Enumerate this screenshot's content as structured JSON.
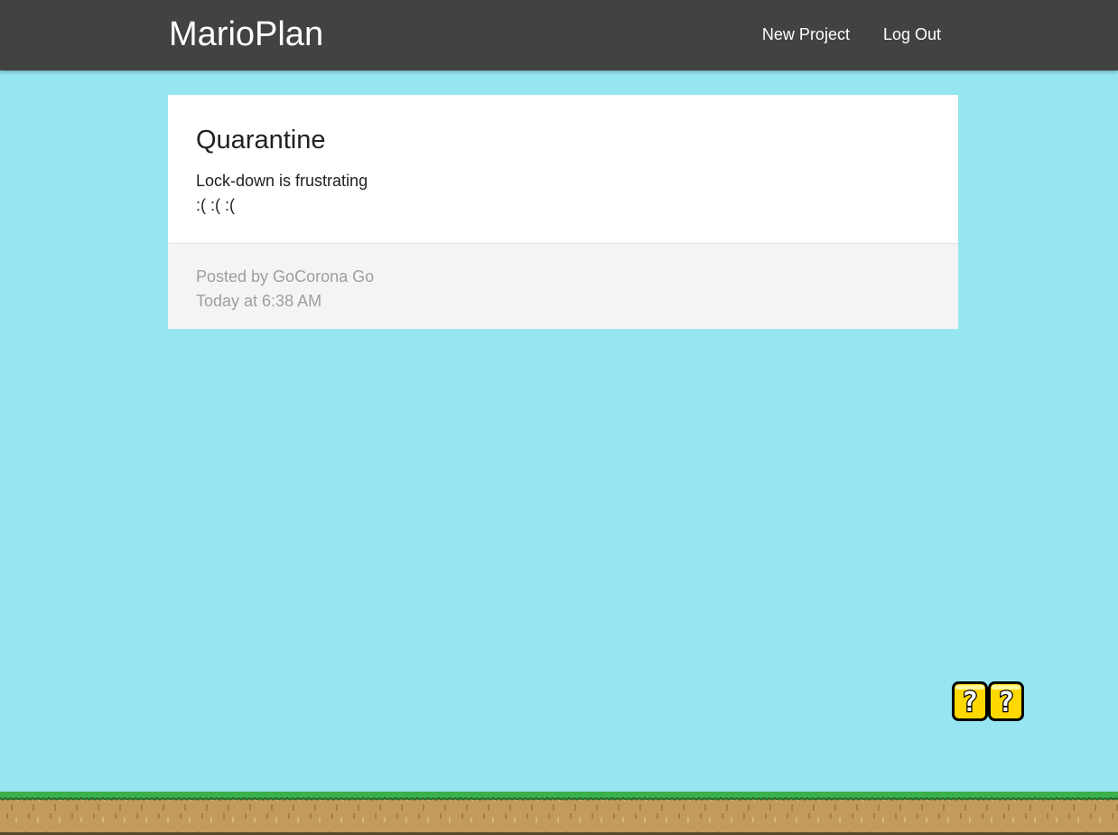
{
  "navbar": {
    "brand": "MarioPlan",
    "links": [
      "New Project",
      "Log Out"
    ]
  },
  "project": {
    "title": "Quarantine",
    "content_lines": [
      "Lock-down is frustrating",
      ":( :( :("
    ],
    "author_line": "Posted by GoCorona Go",
    "timestamp": "Today at 6:38 AM"
  },
  "decor": {
    "blocks": [
      "question-block",
      "question-block"
    ],
    "ground": "grass-ground"
  },
  "colors": {
    "sky": "#95e6f1",
    "navbar": "#424242",
    "card": "#ffffff",
    "card_footer": "#f4f4f4",
    "muted_text": "#9e9e9e",
    "block_yellow": "#ffd800",
    "grass": "#3cb04a",
    "dirt": "#c29a5c"
  }
}
